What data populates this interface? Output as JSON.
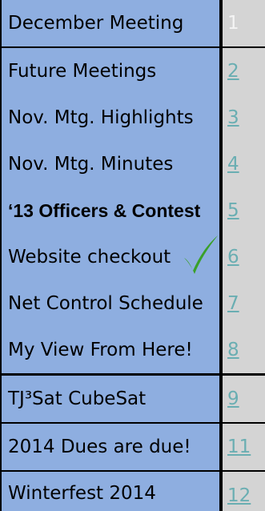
{
  "toc": {
    "rows": [
      {
        "title": "December Meeting",
        "page": "1",
        "linked": false
      },
      {
        "title": "Future Meetings",
        "page": "2",
        "linked": true
      },
      {
        "title": "Nov. Mtg. Highlights",
        "page": "3",
        "linked": true
      },
      {
        "title": "Nov.  Mtg. Minutes",
        "page": "4",
        "linked": true
      },
      {
        "title": "‘13 Officers & Contest",
        "page": "5",
        "linked": true
      },
      {
        "title": "Website checkout",
        "page": "6",
        "linked": true
      },
      {
        "title": "Net Control Schedule",
        "page": "7",
        "linked": true
      },
      {
        "title": "My View From Here!",
        "page": "8",
        "linked": true
      },
      {
        "title": "TJ³Sat CubeSat",
        "page": "9",
        "linked": true
      },
      {
        "title": "2014 Dues are due!",
        "page": "11",
        "linked": true
      },
      {
        "title": " Winterfest 2014",
        "page": "12",
        "linked": true
      }
    ]
  },
  "colors": {
    "title_bg": "#8eaee0",
    "page_bg": "#d4d4d4",
    "link": "#6aaeb2",
    "check": "#3aa02a"
  },
  "icons": {
    "website_checkout_mark": "checkmark-icon"
  }
}
